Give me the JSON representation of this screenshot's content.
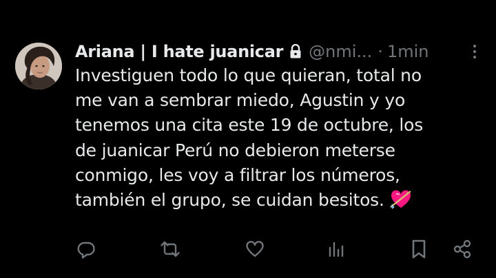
{
  "tweet": {
    "display_name": "Ariana | I hate juanicar",
    "handle": "@nmi...",
    "separator": "·",
    "time": "1min",
    "lines": [
      "Investiguen todo lo que quieran, total no",
      "me van a sembrar miedo, Agustin y yo",
      "tenemos una cita este 19 de octubre, los",
      "de juanicar Perú no debieron meterse",
      "conmigo, les voy a filtrar los números,",
      "también el grupo, se cuidan besitos."
    ],
    "emoji": "heart-with-arrow"
  },
  "actions": {
    "icons": [
      "reply-icon",
      "retweet-icon",
      "like-icon",
      "views-icon",
      "bookmark-icon",
      "share-icon"
    ]
  },
  "colors": {
    "background": "#000000",
    "text": "#e7e9ea",
    "secondary": "#71767b",
    "heart_pink": "#f91880"
  }
}
